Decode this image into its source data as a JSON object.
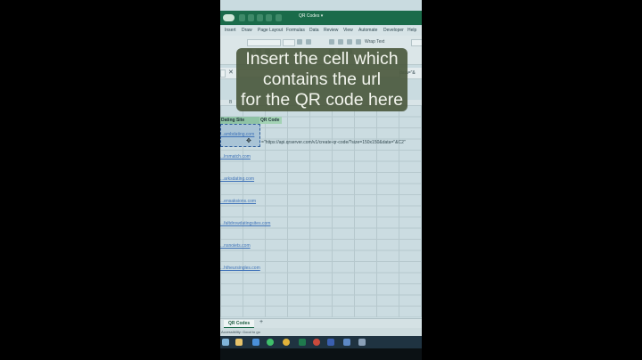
{
  "titlebar": {
    "autosave": "Off",
    "filename": "QR Codes ▾"
  },
  "ribbon": {
    "tabs": [
      "Insert",
      "Draw",
      "Page Layout",
      "Formulas",
      "Data",
      "Review",
      "View",
      "Automate",
      "Developer",
      "Help"
    ],
    "wrap_text": "Wrap Text"
  },
  "formula_bar": {
    "close": "✕",
    "peek": "data=\"&"
  },
  "columns": {
    "b": "B"
  },
  "table": {
    "header_a": "Dating Site",
    "header_b": "QR Code",
    "formula": "=\"https://api.qrserver.com/v1/create-qr-code/?size=150x150&data=\"&C2\"",
    "sites": [
      "...ambdating.com",
      "...lrsmatch.com",
      "...arksdating.com",
      "...ensaksions.com",
      "...faltdrowdatingsites.com",
      "...nsnoiets.com",
      "...htheursingles.com"
    ]
  },
  "sheet": {
    "tab": "QR Codes",
    "add": "+",
    "status": "Accessibility: Good to go"
  },
  "caption": {
    "line1": "Insert the cell which",
    "line2": "contains the url",
    "line3": "for the QR code here"
  },
  "colors": {
    "excel_green": "#1a6b4a",
    "caption_bg": "#4c5a40",
    "link": "#3f73b8"
  }
}
